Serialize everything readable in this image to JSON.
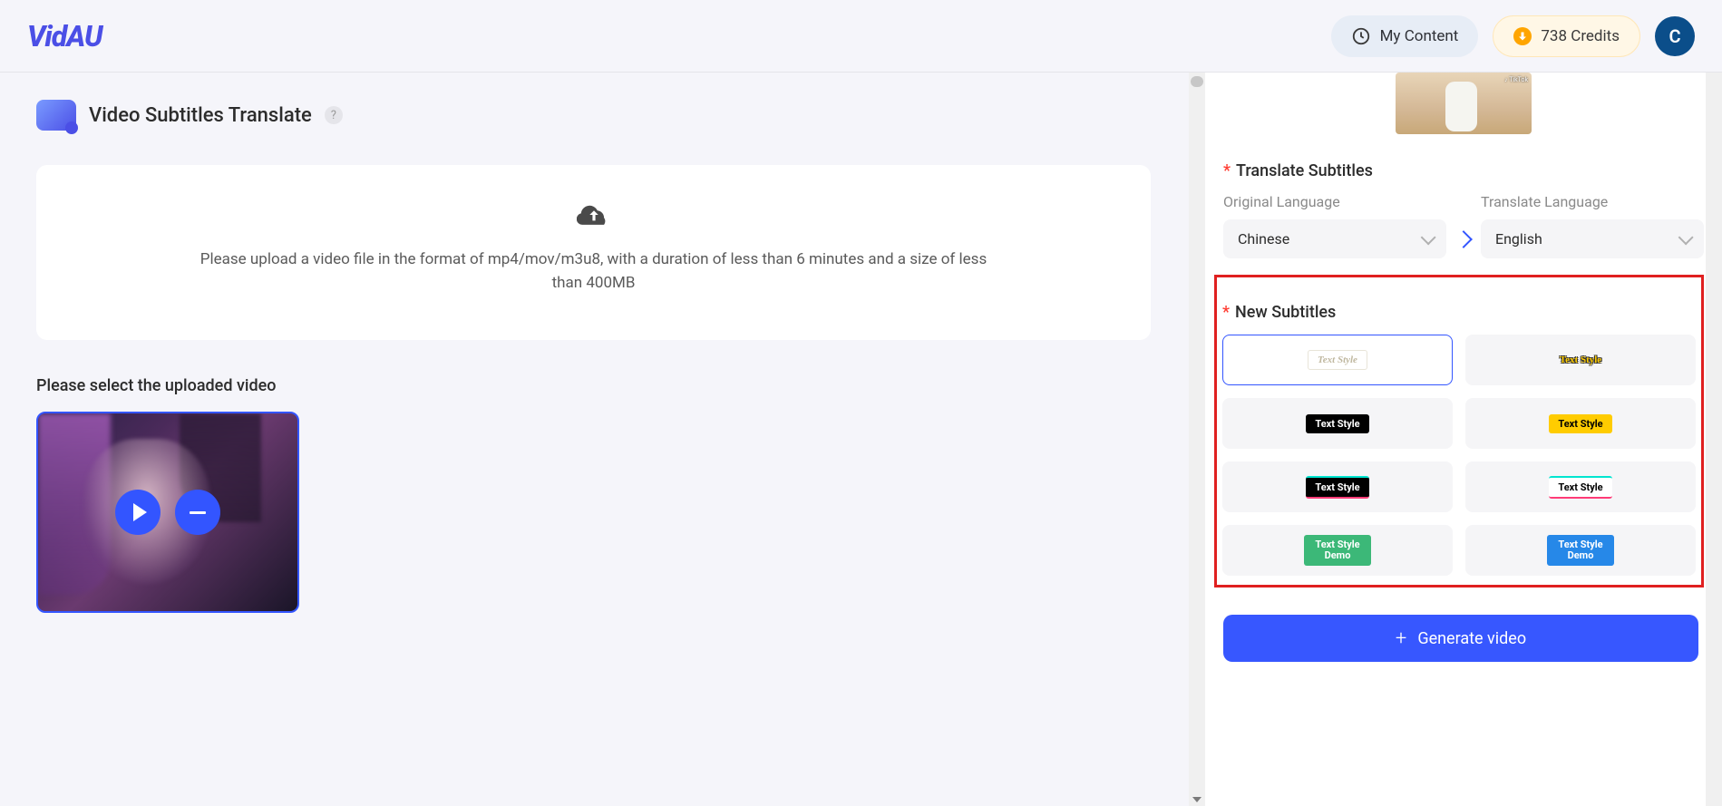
{
  "header": {
    "logo": "VidAU",
    "my_content_label": "My Content",
    "credits_label": "738 Credits",
    "avatar_letter": "C"
  },
  "page": {
    "title": "Video Subtitles Translate",
    "upload_text": "Please upload a video file in the format of mp4/mov/m3u8, with a duration of less than 6 minutes and a size of less than 400MB",
    "select_label": "Please select the uploaded video"
  },
  "translate": {
    "section_label": "Translate Subtitles",
    "original_label": "Original Language",
    "translate_label": "Translate Language",
    "original_value": "Chinese",
    "translate_value": "English"
  },
  "subtitles": {
    "section_label": "New Subtitles",
    "styles": [
      {
        "label": "Text Style",
        "selected": true
      },
      {
        "label": "Text Style",
        "selected": false
      },
      {
        "label": "Text Style",
        "selected": false
      },
      {
        "label": "Text Style",
        "selected": false
      },
      {
        "label": "Text Style",
        "selected": false
      },
      {
        "label": "Text Style",
        "selected": false
      },
      {
        "label": "Text Style\nDemo",
        "selected": false
      },
      {
        "label": "Text Style\nDemo",
        "selected": false
      }
    ]
  },
  "generate_label": "Generate video"
}
